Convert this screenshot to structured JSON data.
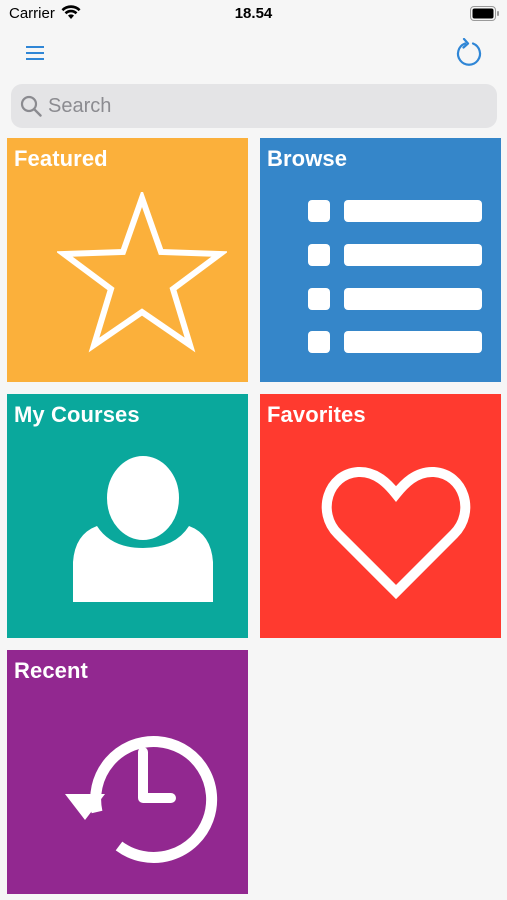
{
  "status_bar": {
    "carrier": "Carrier",
    "time": "18.54",
    "icons": [
      "wifi-icon",
      "battery-icon"
    ]
  },
  "nav_bar": {
    "left_icon": "hamburger-menu-icon",
    "right_icon": "refresh-icon",
    "accent_color": "#2f86d6"
  },
  "search": {
    "placeholder": "Search",
    "value": "",
    "icon": "search-icon"
  },
  "tiles": [
    {
      "label": "Featured",
      "icon": "star-icon",
      "color": "#fbb03b"
    },
    {
      "label": "Browse",
      "icon": "list-icon",
      "color": "#3586c9"
    },
    {
      "label": "My Courses",
      "icon": "user-icon",
      "color": "#0aa89c"
    },
    {
      "label": "Favorites",
      "icon": "heart-icon",
      "color": "#ff3a2f"
    },
    {
      "label": "Recent",
      "icon": "history-icon",
      "color": "#922890"
    }
  ]
}
